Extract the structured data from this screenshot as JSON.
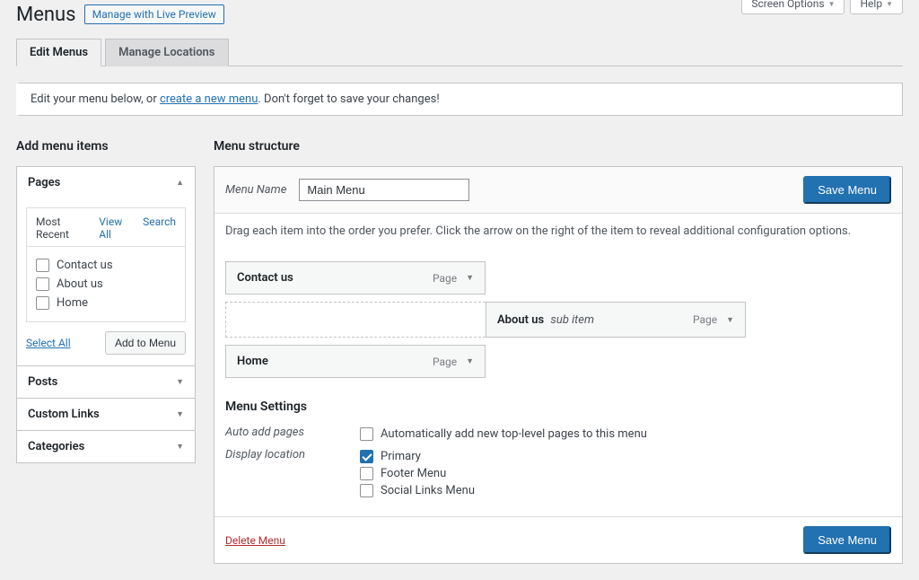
{
  "topbar": {
    "screen_options": "Screen Options",
    "help": "Help"
  },
  "page": {
    "title": "Menus",
    "live_preview": "Manage with Live Preview"
  },
  "tabs": {
    "edit": "Edit Menus",
    "locations": "Manage Locations"
  },
  "notice": {
    "pre": "Edit your menu below, or ",
    "link": "create a new menu",
    "post": ". Don't forget to save your changes!"
  },
  "left": {
    "heading": "Add menu items",
    "pages": {
      "title": "Pages",
      "tabs": {
        "recent": "Most Recent",
        "viewall": "View All",
        "search": "Search"
      },
      "items": [
        "Contact us",
        "About us",
        "Home"
      ],
      "select_all": "Select All",
      "add": "Add to Menu"
    },
    "posts": "Posts",
    "custom": "Custom Links",
    "categories": "Categories"
  },
  "right": {
    "heading": "Menu structure",
    "menu_name_label": "Menu Name",
    "menu_name_value": "Main Menu",
    "save": "Save Menu",
    "hint": "Drag each item into the order you prefer. Click the arrow on the right of the item to reveal additional configuration options.",
    "items": {
      "contact": {
        "label": "Contact us",
        "type": "Page"
      },
      "about": {
        "label": "About us",
        "sub": "sub item",
        "type": "Page"
      },
      "home": {
        "label": "Home",
        "type": "Page"
      }
    },
    "settings": {
      "heading": "Menu Settings",
      "auto_label": "Auto add pages",
      "auto_opt": "Automatically add new top-level pages to this menu",
      "loc_label": "Display location",
      "loc_primary": "Primary",
      "loc_footer": "Footer Menu",
      "loc_social": "Social Links Menu"
    },
    "delete": "Delete Menu"
  }
}
